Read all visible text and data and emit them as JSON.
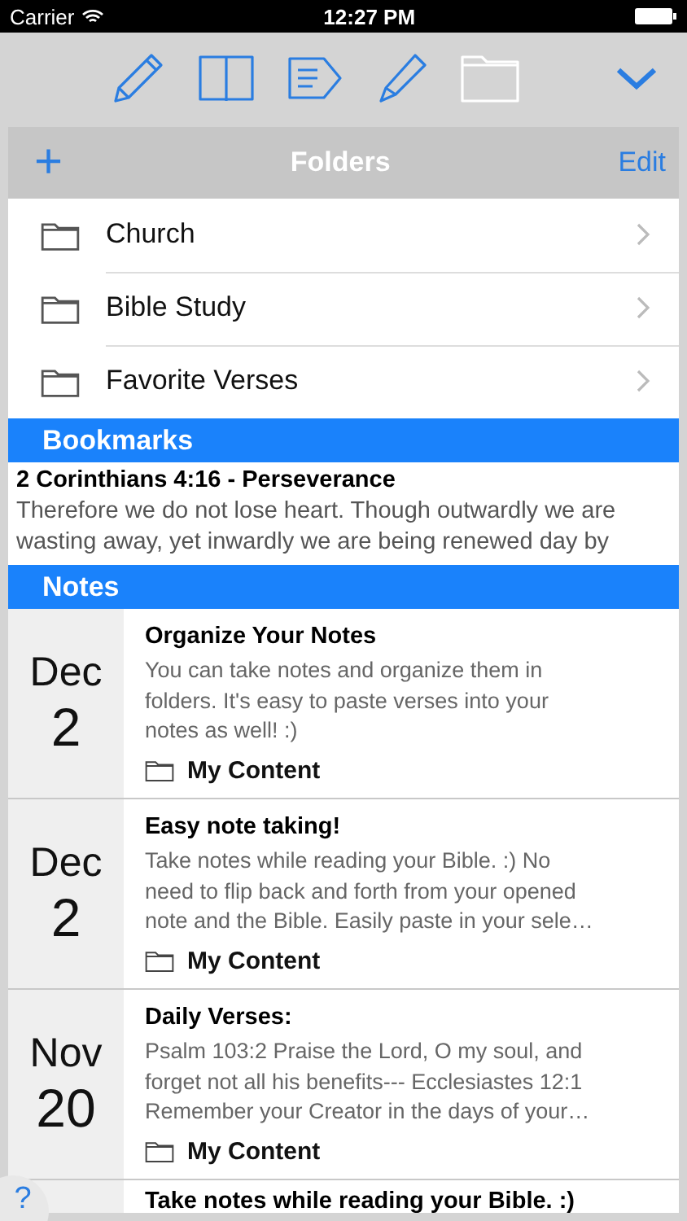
{
  "status_bar": {
    "carrier": "Carrier",
    "time": "12:27 PM"
  },
  "toolbar": {
    "tools": [
      {
        "kind": "pencil",
        "selected": false
      },
      {
        "kind": "book",
        "selected": false
      },
      {
        "kind": "tag",
        "selected": false
      },
      {
        "kind": "highlighter",
        "selected": false
      },
      {
        "kind": "folder",
        "selected": true
      }
    ]
  },
  "folders": {
    "title": "Folders",
    "add": "+",
    "edit": "Edit",
    "items": [
      {
        "name": "Church"
      },
      {
        "name": "Bible Study"
      },
      {
        "name": "Favorite Verses"
      }
    ]
  },
  "bookmarks": {
    "title": "Bookmarks",
    "items": [
      {
        "title": "2 Corinthians 4:16 - Perseverance",
        "text": "Therefore we do not lose heart. Though outwardly we are\nwasting away, yet inwardly we are being renewed day by"
      }
    ]
  },
  "notes": {
    "title": "Notes",
    "items": [
      {
        "month": "Dec",
        "day": "2",
        "title": "Organize Your Notes",
        "body": "You can take notes and organize them in\nfolders. It's easy to paste verses into your\nnotes as well! :)",
        "folder": "My Content"
      },
      {
        "month": "Dec",
        "day": "2",
        "title": "Easy note taking!",
        "body": "Take notes while reading your Bible. :)   No\nneed to flip back and forth from your opened\nnote and the Bible. Easily paste in your sele…",
        "folder": "My Content"
      },
      {
        "month": "Nov",
        "day": "20",
        "title": "Daily Verses:",
        "body": "Psalm 103:2 Praise the Lord, O my soul, and\nforget not all his benefits---  Ecclesiastes 12:1\nRemember your Creator in the days of your…",
        "folder": "My Content"
      },
      {
        "title": "Take notes while reading your Bible. :)"
      }
    ]
  },
  "help": "?"
}
